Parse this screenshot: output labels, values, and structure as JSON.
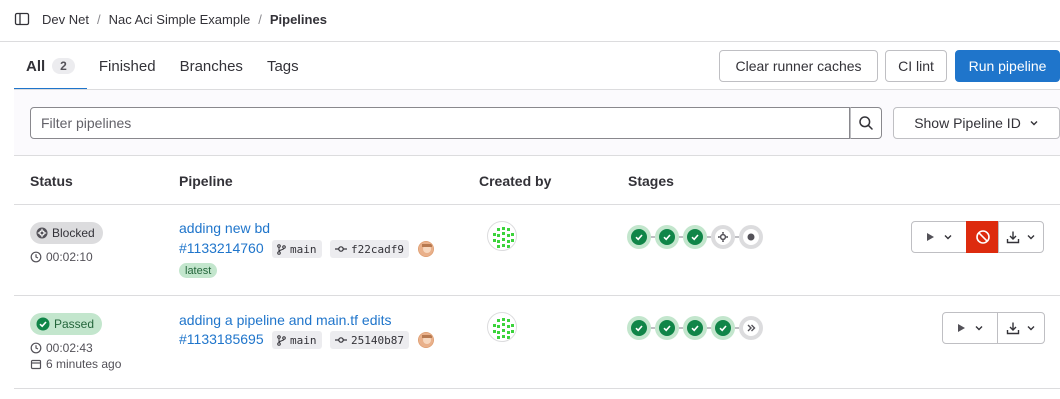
{
  "breadcrumb": {
    "items": [
      "Dev Net",
      "Nac Aci Simple Example"
    ],
    "current": "Pipelines"
  },
  "tabs": [
    {
      "label": "All",
      "count": "2"
    },
    {
      "label": "Finished"
    },
    {
      "label": "Branches"
    },
    {
      "label": "Tags"
    }
  ],
  "actions": {
    "clear_caches": "Clear runner caches",
    "ci_lint": "CI lint",
    "run_pipeline": "Run pipeline"
  },
  "filter": {
    "placeholder": "Filter pipelines",
    "show_id_label": "Show Pipeline ID"
  },
  "table": {
    "headers": {
      "status": "Status",
      "pipeline": "Pipeline",
      "created_by": "Created by",
      "stages": "Stages"
    },
    "rows": [
      {
        "status": "Blocked",
        "duration": "00:02:10",
        "finished": "",
        "title": "adding new bd",
        "id": "#1133214760",
        "branch": "main",
        "commit": "f22cadf9",
        "badge": "latest",
        "stages": [
          "success",
          "success",
          "success",
          "manual",
          "skipped"
        ]
      },
      {
        "status": "Passed",
        "duration": "00:02:43",
        "finished": "6 minutes ago",
        "title": "adding a pipeline and main.tf edits",
        "id": "#1133185695",
        "branch": "main",
        "commit": "25140b87",
        "badge": "",
        "stages": [
          "success",
          "success",
          "success",
          "success",
          "skipped-forward"
        ]
      }
    ]
  },
  "colors": {
    "accent": "#1f75cb",
    "success": "#108548",
    "danger": "#dd2b0e"
  }
}
